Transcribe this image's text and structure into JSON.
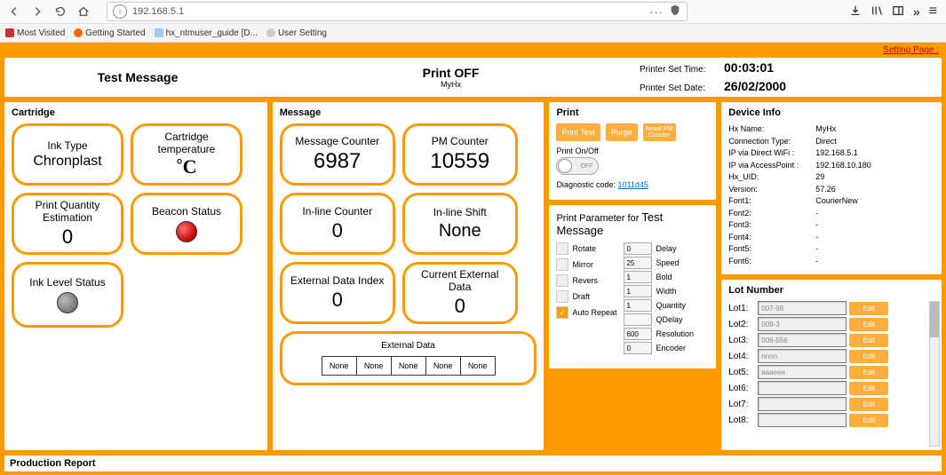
{
  "browser": {
    "url": "192.168.5.1",
    "url_more": "···",
    "menu_icon": "≡"
  },
  "bookmarks": {
    "most_visited": "Most Visited",
    "getting_started": "Getting Started",
    "guide": "hx_ntmuser_guide [D...",
    "user_setting": "User Setting"
  },
  "setting_page": "Setting Page :",
  "header": {
    "message_name": "Test Message",
    "print_status": "Print OFF",
    "device_short": "MyHx",
    "time_label": "Printer Set Time:",
    "time_value": "00:03:01",
    "date_label": "Printer Set Date:",
    "date_value": "26/02/2000"
  },
  "cartridge": {
    "title": "Cartridge",
    "ink_type_label": "Ink Type",
    "ink_type_value": "Chronplast",
    "temp_label": "Cartridge temperature",
    "temp_unit": "°C",
    "print_qty_label": "Print Quantity Estimation",
    "print_qty_value": "0",
    "beacon_label": "Beacon Status",
    "ink_level_label": "Ink Level Status"
  },
  "message": {
    "title": "Message",
    "msg_counter_label": "Message Counter",
    "msg_counter_value": "6987",
    "pm_counter_label": "PM Counter",
    "pm_counter_value": "10559",
    "inline_counter_label": "In-line Counter",
    "inline_counter_value": "0",
    "inline_shift_label": "In-line Shift",
    "inline_shift_value": "None",
    "ext_index_label": "External Data Index",
    "ext_index_value": "0",
    "cur_ext_label": "Current External Data",
    "cur_ext_value": "0",
    "ext_data_title": "External Data",
    "ext_cells": [
      "None",
      "None",
      "None",
      "None",
      "None"
    ]
  },
  "print": {
    "title": "Print",
    "btn_print_test": "Print Test",
    "btn_purge": "Purge",
    "btn_reset_pm": "Reset PM Counter",
    "onoff_label": "Print On/Off",
    "toggle_state": "OFF",
    "diag_label": "Diagnostic code:",
    "diag_code": "1011d45"
  },
  "param": {
    "title_prefix": "Print Parameter for ",
    "title_msg": "Test Message",
    "checks": {
      "rotate": "Rotate",
      "mirror": "Mirror",
      "revers": "Revers",
      "draft": "Draft",
      "auto_repeat": "Auto Repeat"
    },
    "fields": [
      {
        "v": "0",
        "l": "Delay"
      },
      {
        "v": "25",
        "l": "Speed"
      },
      {
        "v": "1",
        "l": "Bold"
      },
      {
        "v": "1",
        "l": "Width"
      },
      {
        "v": "1",
        "l": "Quantity"
      },
      {
        "v": "",
        "l": "QDelay"
      },
      {
        "v": "600",
        "l": "Resolution"
      },
      {
        "v": "0",
        "l": "Encoder"
      }
    ]
  },
  "device": {
    "title": "Device Info",
    "rows": [
      {
        "k": "Hx Name:",
        "v": "MyHx"
      },
      {
        "k": "Connection Type:",
        "v": "Direct"
      },
      {
        "k": "IP via Direct WiFi :",
        "v": "192.168.5.1"
      },
      {
        "k": "IP via AccessPoint :",
        "v": "192.168.10.180"
      },
      {
        "k": "Hx_UID:",
        "v": "29"
      },
      {
        "k": "Version:",
        "v": "57.26"
      },
      {
        "k": "Font1:",
        "v": "CourierNew"
      },
      {
        "k": "Font2:",
        "v": "-"
      },
      {
        "k": "Font3:",
        "v": "-"
      },
      {
        "k": "Font4:",
        "v": "-"
      },
      {
        "k": "Font5:",
        "v": "-"
      },
      {
        "k": "Font6:",
        "v": "-"
      }
    ]
  },
  "lot": {
    "title": "Lot Number",
    "edit": "Edit",
    "rows": [
      {
        "k": "Lot1:",
        "v": "007-98"
      },
      {
        "k": "Lot2:",
        "v": "009-3"
      },
      {
        "k": "Lot3:",
        "v": "009-556"
      },
      {
        "k": "Lot4:",
        "v": "nnnn"
      },
      {
        "k": "Lot5:",
        "v": "aaaeee"
      },
      {
        "k": "Lot6:",
        "v": ""
      },
      {
        "k": "Lot7:",
        "v": ""
      },
      {
        "k": "Lot8:",
        "v": ""
      }
    ]
  },
  "production_report": "Production Report"
}
